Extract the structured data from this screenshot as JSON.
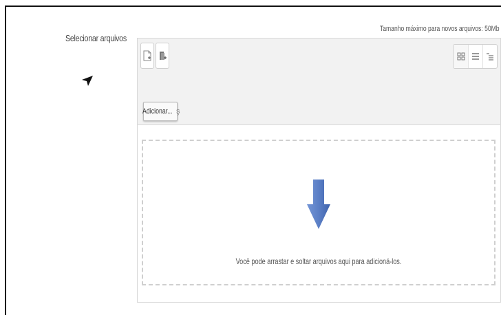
{
  "form": {
    "field_label": "Selecionar arquivos"
  },
  "filemanager": {
    "max_size_text": "Tamanho máximo para novos arquivos: 50Mb",
    "toolbar": {
      "add_file_icon": "add-file-icon",
      "create_folder_icon": "create-folder-icon",
      "view_buttons": [
        "icons-view-icon",
        "list-view-icon",
        "tree-view-icon"
      ]
    },
    "add_button_label": "Adicionar...",
    "dropzone_text": "Você pode arrastar e soltar arquivos aqui para adicioná-los.",
    "colors": {
      "arrow": "#5b7fc6",
      "border": "#d8d8d8",
      "toolbar_bg": "#f2f2f2"
    }
  }
}
